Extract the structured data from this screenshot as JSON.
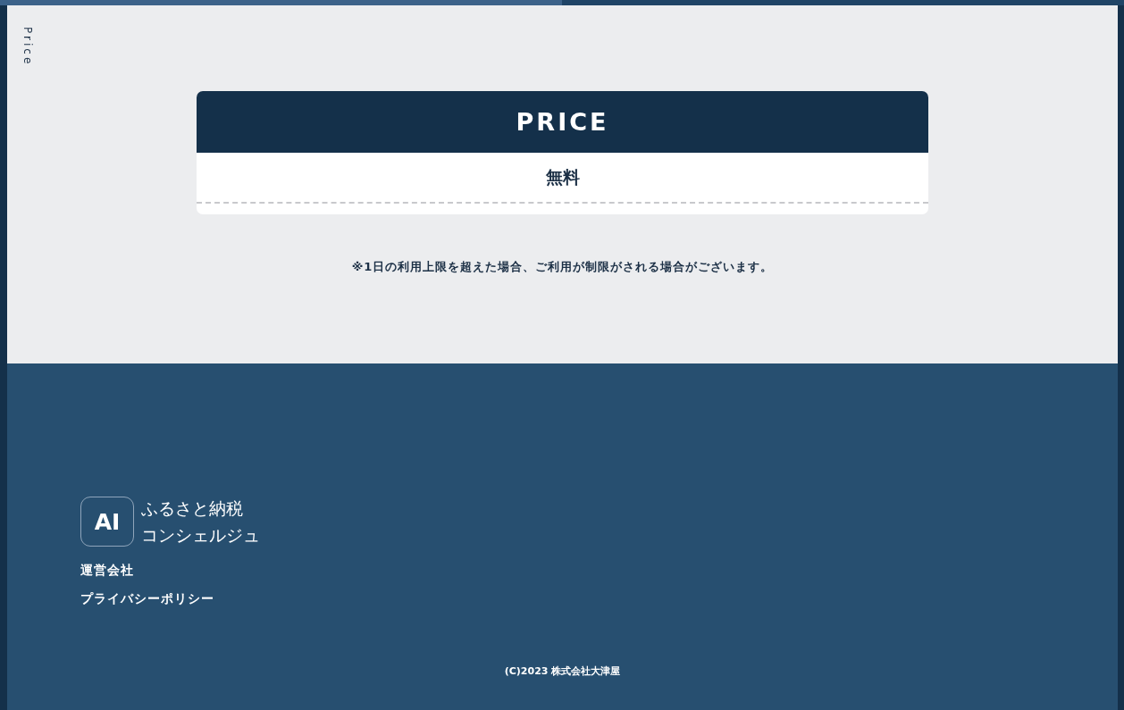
{
  "progress": {
    "level": 0.5
  },
  "side_label": "Price",
  "price_card": {
    "title": "PRICE",
    "value": "無料"
  },
  "note": "※1日の利用上限を超えた場合、ご利用が制限がされる場合がございます。",
  "footer": {
    "logo": {
      "mark": "AI",
      "line_1": "ふるさと納税",
      "line_2": "コンシェルジュ"
    },
    "links": [
      "運営会社",
      "プライバシーポリシー"
    ],
    "copyright": "(C)2023 株式会社大津屋"
  }
}
